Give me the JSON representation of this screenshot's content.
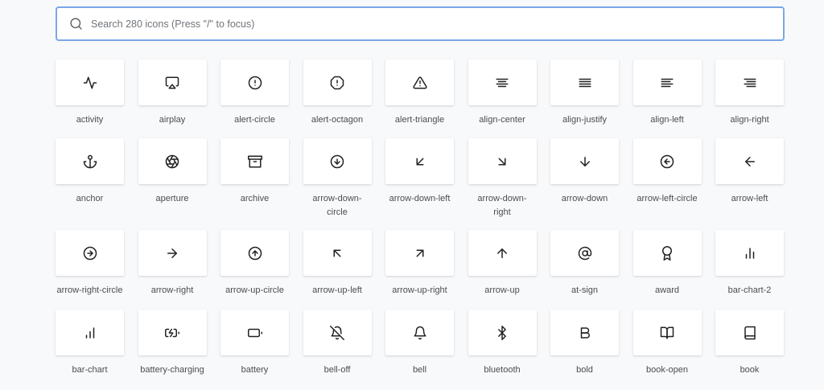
{
  "search": {
    "placeholder": "Search 280 icons (Press \"/\" to focus)",
    "value": ""
  },
  "rows": [
    [
      "activity",
      "airplay",
      "alert-circle",
      "alert-octagon",
      "alert-triangle",
      "align-center",
      "align-justify",
      "align-left",
      "align-right"
    ],
    [
      "anchor",
      "aperture",
      "archive",
      "arrow-down-circle",
      "arrow-down-left",
      "arrow-down-right",
      "arrow-down",
      "arrow-left-circle",
      "arrow-left"
    ],
    [
      "arrow-right-circle",
      "arrow-right",
      "arrow-up-circle",
      "arrow-up-left",
      "arrow-up-right",
      "arrow-up",
      "at-sign",
      "award",
      "bar-chart-2"
    ],
    [
      "bar-chart",
      "battery-charging",
      "battery",
      "bell-off",
      "bell",
      "bluetooth",
      "bold",
      "book-open",
      "book"
    ]
  ],
  "labels": {
    "activity": "activity",
    "airplay": "airplay",
    "alert-circle": "alert-circle",
    "alert-octagon": "alert-octagon",
    "alert-triangle": "alert-triangle",
    "align-center": "align-center",
    "align-justify": "align-justify",
    "align-left": "align-left",
    "align-right": "align-right",
    "anchor": "anchor",
    "aperture": "aperture",
    "archive": "archive",
    "arrow-down-circle": "arrow-down-\ncircle",
    "arrow-down-left": "arrow-down-left",
    "arrow-down-right": "arrow-down-\nright",
    "arrow-down": "arrow-down",
    "arrow-left-circle": "arrow-left-circle",
    "arrow-left": "arrow-left",
    "arrow-right-circle": "arrow-right-circle",
    "arrow-right": "arrow-right",
    "arrow-up-circle": "arrow-up-circle",
    "arrow-up-left": "arrow-up-left",
    "arrow-up-right": "arrow-up-right",
    "arrow-up": "arrow-up",
    "at-sign": "at-sign",
    "award": "award",
    "bar-chart-2": "bar-chart-2",
    "bar-chart": "bar-chart",
    "battery-charging": "battery-charging",
    "battery": "battery",
    "bell-off": "bell-off",
    "bell": "bell",
    "bluetooth": "bluetooth",
    "bold": "bold",
    "book-open": "book-open",
    "book": "book"
  },
  "colors": {
    "search_border": "#7aa7e8",
    "icon_stroke": "#222222",
    "page_bg": "#f8f9fb"
  }
}
